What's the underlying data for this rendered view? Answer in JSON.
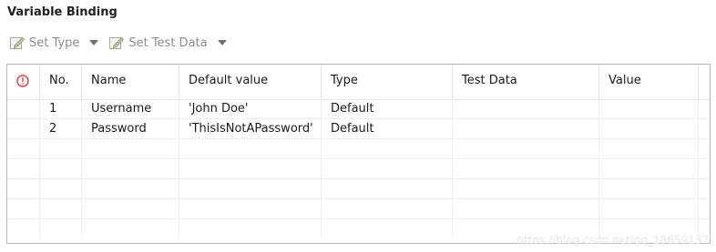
{
  "panel": {
    "title": "Variable Binding"
  },
  "toolbar": {
    "set_type_label": "Set Type",
    "set_test_data_label": "Set Test Data",
    "icons": [
      "edit-icon",
      "chevron-down-icon"
    ]
  },
  "table": {
    "headers": [
      "No.",
      "Name",
      "Default value",
      "Type",
      "Test Data",
      "Value"
    ],
    "rows": [
      {
        "no": "1",
        "name": "Username",
        "default_value": "'John Doe'",
        "type": "Default",
        "test_data": "",
        "value": ""
      },
      {
        "no": "2",
        "name": "Password",
        "default_value": "'ThisIsNotAPassword'",
        "type": "Default",
        "test_data": "",
        "value": ""
      }
    ]
  },
  "watermark": "https://blog.csdn.net/qq_18659137",
  "colors": {
    "warning": "#e23b3b",
    "disabled_text": "#8c8c8c",
    "border": "#b9b9b9"
  }
}
